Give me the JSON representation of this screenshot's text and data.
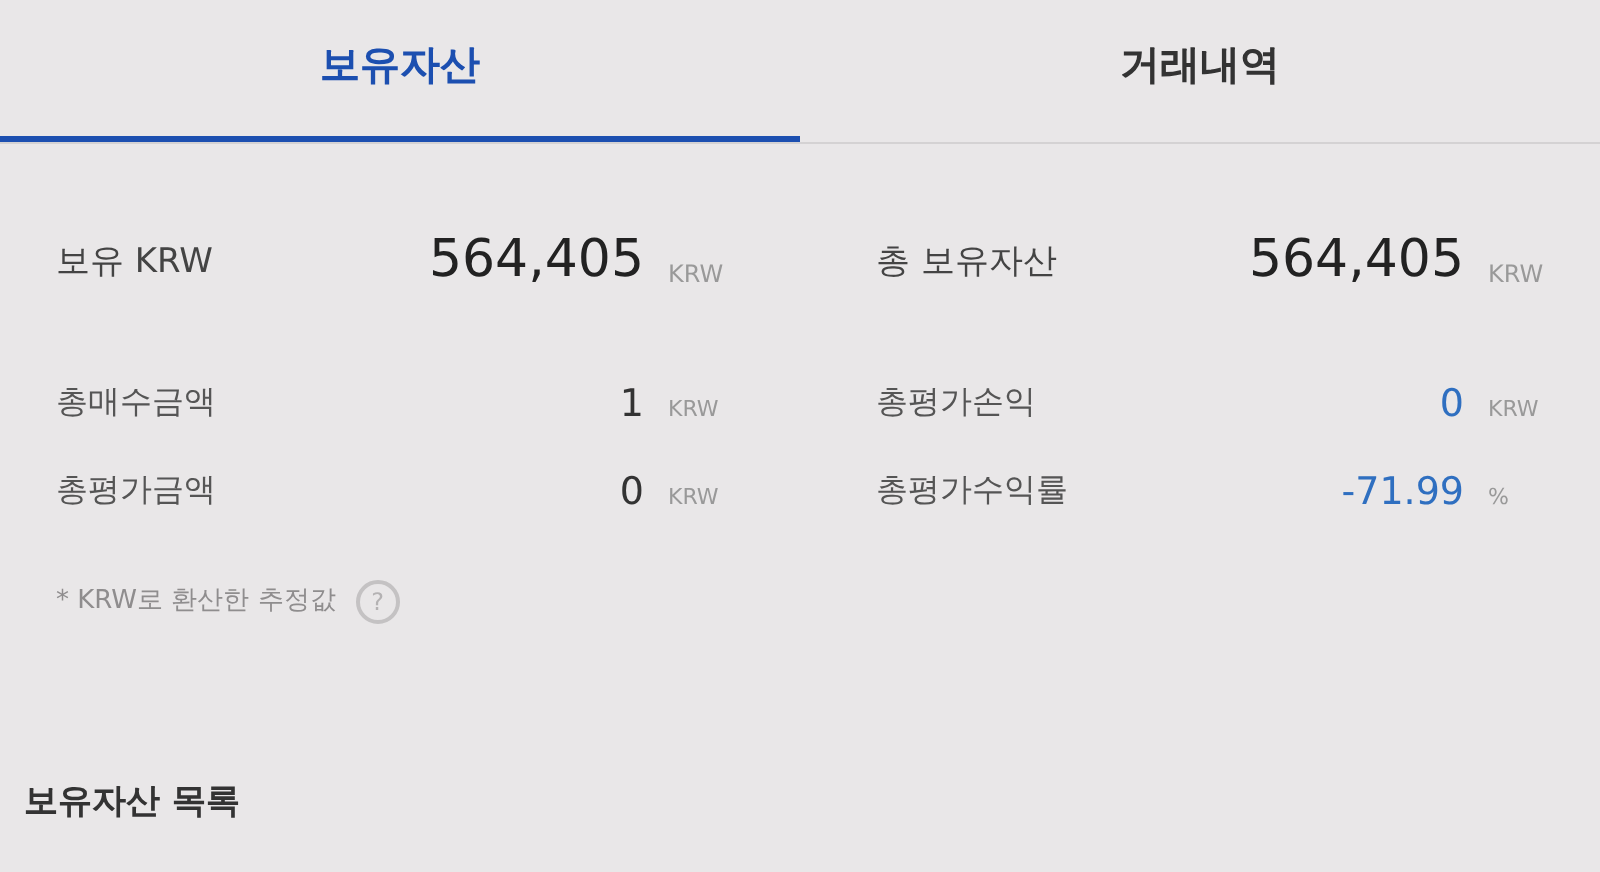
{
  "tabs": [
    {
      "label": "보유자산",
      "selected": true
    },
    {
      "label": "거래내역",
      "selected": false
    }
  ],
  "summary": [
    {
      "label": "보유 KRW",
      "value": "564,405",
      "unit": "KRW"
    },
    {
      "label": "총 보유자산",
      "value": "564,405",
      "unit": "KRW"
    }
  ],
  "stats": [
    {
      "label": "총매수금액",
      "value": "1",
      "unit": "KRW",
      "color": "#333333"
    },
    {
      "label": "총평가손익",
      "value": "0",
      "unit": "KRW",
      "color": "#2f6fc0"
    },
    {
      "label": "총평가금액",
      "value": "0",
      "unit": "KRW",
      "color": "#333333"
    },
    {
      "label": "총평가수익률",
      "value": "-71.99",
      "unit": "%",
      "color": "#2f6fc0"
    }
  ],
  "note": {
    "text": "* KRW로 환산한 추정값",
    "help": "?"
  },
  "section_title": "보유자산 목록"
}
